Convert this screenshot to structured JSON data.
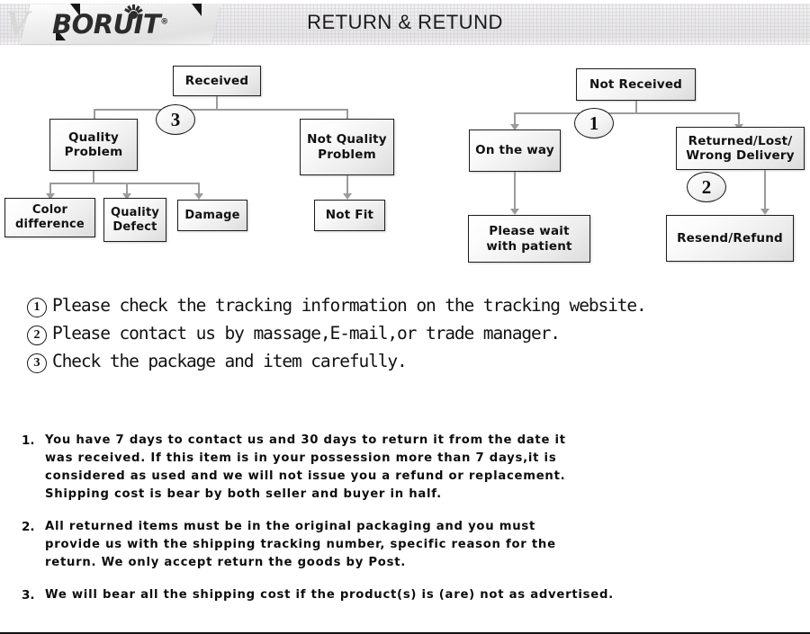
{
  "header": {
    "title": "RETURN & RETUND",
    "logo_text": "BORUIT",
    "logo_registered": "®",
    "logo_vmark": "V"
  },
  "flowchart": {
    "left": {
      "root": "Received",
      "branch_marker": "3",
      "children": [
        {
          "label": "Quality\nProblem"
        },
        {
          "label": "Not Quality\nProblem"
        }
      ],
      "leaves_left": [
        {
          "label": "Color\ndifference"
        },
        {
          "label": "Quality\nDefect"
        },
        {
          "label": "Damage"
        }
      ],
      "leaves_right": [
        {
          "label": "Not Fit"
        }
      ]
    },
    "right": {
      "root": "Not  Received",
      "branch_marker": "1",
      "second_marker": "2",
      "children": [
        {
          "label": "On the way"
        },
        {
          "label": "Returned/Lost/\nWrong Delivery"
        }
      ],
      "leaves_left": [
        {
          "label": "Please wait\nwith patient"
        }
      ],
      "leaves_right": [
        {
          "label": "Resend/Refund"
        }
      ]
    }
  },
  "notes": [
    {
      "num": "1",
      "text": "Please check the tracking information on the tracking website."
    },
    {
      "num": "2",
      "text": "Please contact us by  massage,E-mail,or trade manager."
    },
    {
      "num": "3",
      "text": "Check the package and item carefully."
    }
  ],
  "policy": [
    {
      "num": "1.",
      "lines": [
        "You have 7 days to contact us and 30 days to return it from the date it",
        "was received. If this item is in your possession more than 7 days,it is",
        "considered as used and we will not issue you a refund or replacement.",
        "Shipping cost is bear by both seller and buyer in half."
      ]
    },
    {
      "num": "2.",
      "lines": [
        "All returned items must be in the original packaging and you must",
        "provide us with the shipping tracking number, specific reason for the",
        "return. We only accept return the goods by Post."
      ]
    },
    {
      "num": "3.",
      "lines": [
        "We will bear all the shipping cost if the product(s) is (are) not as advertised."
      ]
    }
  ],
  "colors": {
    "ink": "#111111",
    "connector": "#9b9b9b",
    "band": "#e9e9ea"
  }
}
